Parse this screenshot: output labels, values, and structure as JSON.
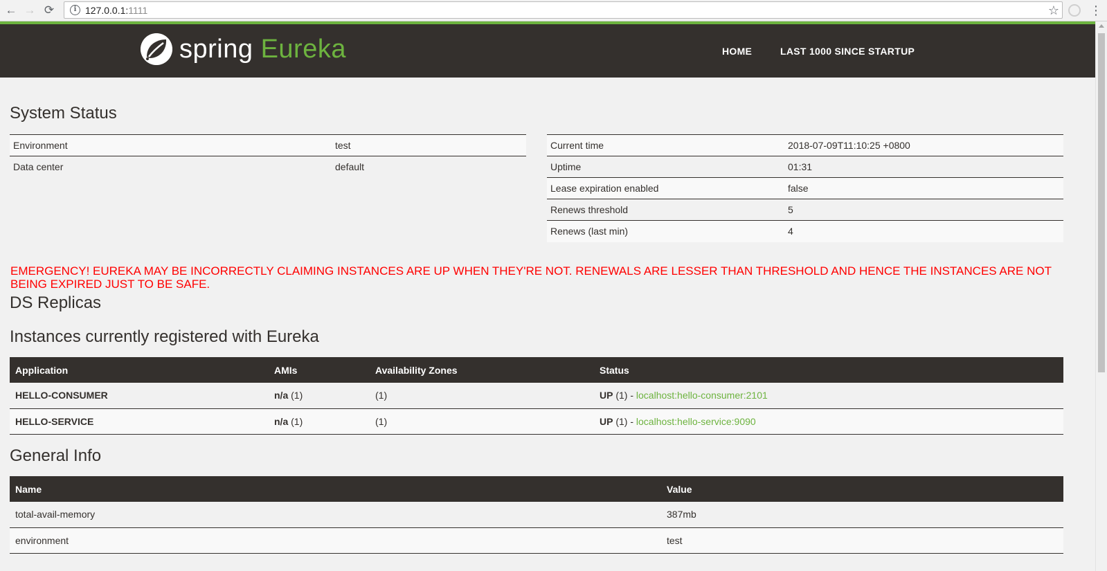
{
  "browser": {
    "back_icon": "←",
    "forward_icon": "→",
    "reload_icon": "⟳",
    "url_host": "127.0.0.1:",
    "url_port": "1111",
    "star_icon": "☆",
    "menu_icon": "⋮"
  },
  "header": {
    "logo_spring": "spring",
    "logo_eureka": "Eureka",
    "nav_home": "HOME",
    "nav_last1000": "LAST 1000 SINCE STARTUP"
  },
  "system_status": {
    "title": "System Status",
    "left": [
      {
        "label": "Environment",
        "value": "test"
      },
      {
        "label": "Data center",
        "value": "default"
      }
    ],
    "right": [
      {
        "label": "Current time",
        "value": "2018-07-09T11:10:25 +0800"
      },
      {
        "label": "Uptime",
        "value": "01:31"
      },
      {
        "label": "Lease expiration enabled",
        "value": "false"
      },
      {
        "label": "Renews threshold",
        "value": "5"
      },
      {
        "label": "Renews (last min)",
        "value": "4"
      }
    ]
  },
  "emergency": "EMERGENCY! EUREKA MAY BE INCORRECTLY CLAIMING INSTANCES ARE UP WHEN THEY'RE NOT. RENEWALS ARE LESSER THAN THRESHOLD AND HENCE THE INSTANCES ARE NOT BEING EXPIRED JUST TO BE SAFE.",
  "ds_replicas": {
    "title": "DS Replicas"
  },
  "instances": {
    "title": "Instances currently registered with Eureka",
    "headers": [
      "Application",
      "AMIs",
      "Availability Zones",
      "Status"
    ],
    "rows": [
      {
        "application": "HELLO-CONSUMER",
        "ami": "n/a",
        "ami_count": "(1)",
        "zones": "(1)",
        "status": "UP",
        "status_count": "(1) -",
        "link": "localhost:hello-consumer:2101"
      },
      {
        "application": "HELLO-SERVICE",
        "ami": "n/a",
        "ami_count": "(1)",
        "zones": "(1)",
        "status": "UP",
        "status_count": "(1) -",
        "link": "localhost:hello-service:9090"
      }
    ]
  },
  "general_info": {
    "title": "General Info",
    "headers": [
      "Name",
      "Value"
    ],
    "rows": [
      {
        "name": "total-avail-memory",
        "value": "387mb"
      },
      {
        "name": "environment",
        "value": "test"
      }
    ]
  }
}
